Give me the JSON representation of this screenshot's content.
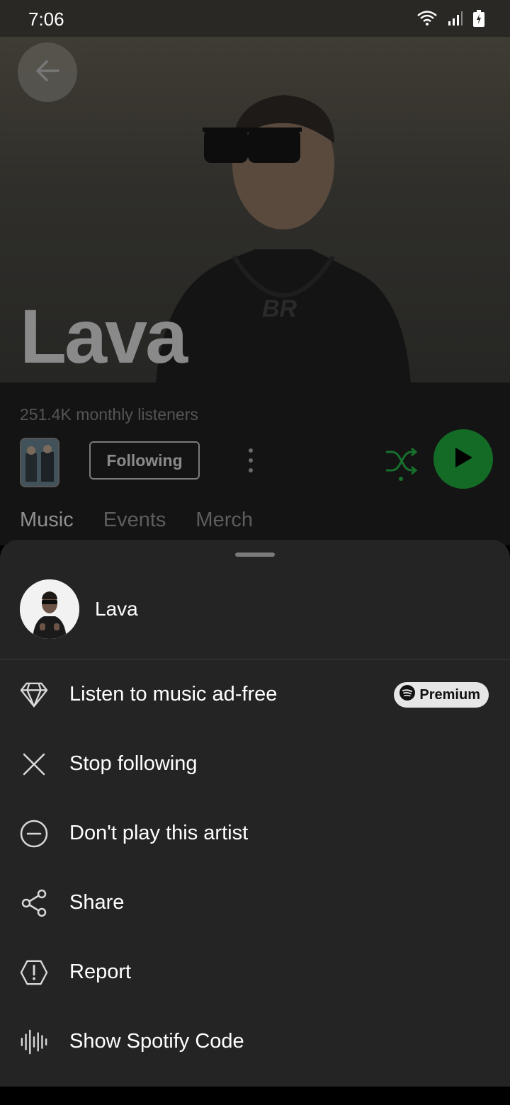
{
  "status_bar": {
    "time": "7:06"
  },
  "hero": {
    "artist_name": "Lava"
  },
  "profile": {
    "monthly_listeners": "251.4K monthly listeners",
    "follow_label": "Following",
    "tabs": [
      {
        "label": "Music",
        "active": true
      },
      {
        "label": "Events",
        "active": false
      },
      {
        "label": "Merch",
        "active": false
      }
    ]
  },
  "sheet": {
    "title": "Lava",
    "items": [
      {
        "label": "Listen to music ad-free",
        "icon": "diamond-icon",
        "badge": "Premium"
      },
      {
        "label": "Stop following",
        "icon": "close-icon"
      },
      {
        "label": "Don't play this artist",
        "icon": "minus-circle-icon"
      },
      {
        "label": "Share",
        "icon": "share-icon"
      },
      {
        "label": "Report",
        "icon": "report-icon"
      },
      {
        "label": "Show Spotify Code",
        "icon": "spotify-code-icon"
      }
    ]
  },
  "colors": {
    "accent": "#1ed760",
    "sheet_bg": "#242424",
    "play_button": "#136b26"
  }
}
